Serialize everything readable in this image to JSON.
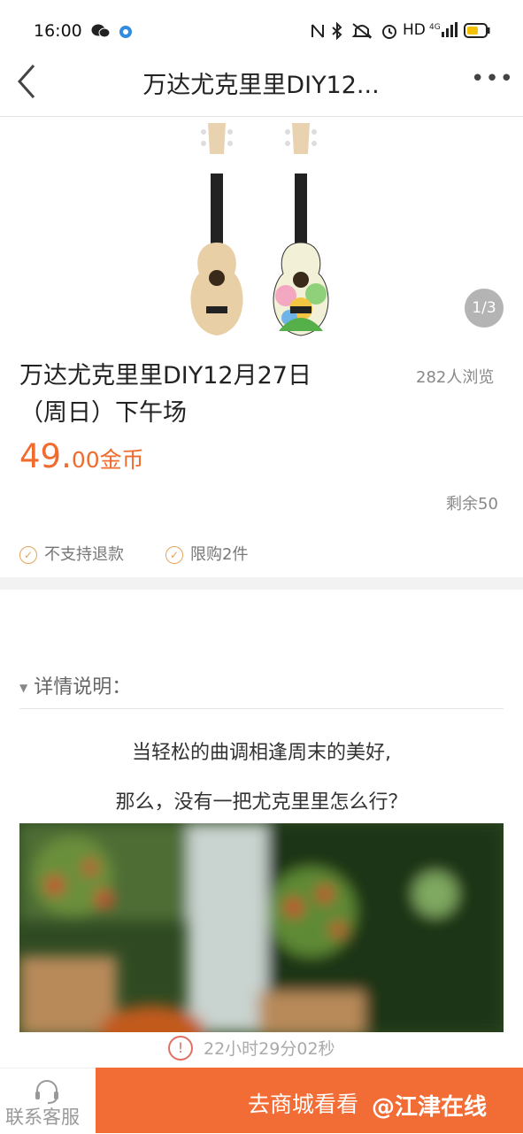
{
  "status_bar": {
    "time": "16:00",
    "network": "HD",
    "signal": "4G"
  },
  "nav": {
    "title": "万达尤克里里DIY12...",
    "more": "•••"
  },
  "product": {
    "image_counter": "1/3",
    "title_line1": "万达尤克里里DIY12月27日",
    "title_line2": "（周日）下午场",
    "views": "282人浏览",
    "price_int": "49.",
    "price_dec": "00",
    "price_unit": "金币",
    "remain": "剩余50",
    "tags": [
      "不支持退款",
      "限购2件"
    ]
  },
  "details": {
    "heading": "详情说明：",
    "lines": [
      "当轻松的曲调相逢周末的美好,",
      "那么，没有一把尤克里里怎么行？"
    ]
  },
  "timer": {
    "text": "22小时29分02秒"
  },
  "bottom": {
    "support_label": "联系客服",
    "cta_label": "去商城看看",
    "watermark": "@江津在线"
  },
  "colors": {
    "accent": "#f26c36",
    "price": "#ef6c2e"
  }
}
